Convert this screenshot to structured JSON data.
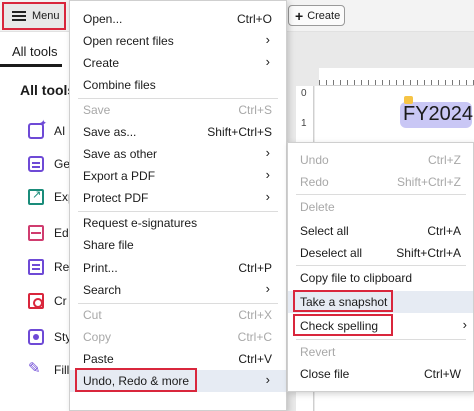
{
  "header": {
    "menu_label": "Menu",
    "create_label": "Create"
  },
  "sidebar": {
    "tab_label": "All tools",
    "panel_title": "All tools",
    "tools": [
      {
        "label": "AI",
        "icon": "ai-assistant-icon"
      },
      {
        "label": "Ge",
        "icon": "generate-icon"
      },
      {
        "label": "Exp",
        "icon": "export-pdf-icon"
      },
      {
        "label": "Ed",
        "icon": "edit-pdf-icon"
      },
      {
        "label": "Re",
        "icon": "request-signature-icon"
      },
      {
        "label": "Cr",
        "icon": "create-pdf-icon"
      },
      {
        "label": "Sty",
        "icon": "style-icon"
      },
      {
        "label": "Fill",
        "icon": "fill-sign-icon"
      }
    ]
  },
  "document": {
    "ruler_mark_0": "0",
    "ruler_mark_1": "1",
    "text_box": "FY2024"
  },
  "main_menu": {
    "items": [
      {
        "label": "Open...",
        "shortcut": "Ctrl+O"
      },
      {
        "label": "Open recent files",
        "submenu": "›"
      },
      {
        "label": "Create",
        "submenu": "›"
      },
      {
        "label": "Combine files"
      },
      {
        "label": "Save",
        "shortcut": "Ctrl+S"
      },
      {
        "label": "Save as...",
        "shortcut": "Shift+Ctrl+S"
      },
      {
        "label": "Save as other",
        "submenu": "›"
      },
      {
        "label": "Export a PDF",
        "submenu": "›"
      },
      {
        "label": "Protect PDF",
        "submenu": "›"
      },
      {
        "label": "Request e-signatures"
      },
      {
        "label": "Share file"
      },
      {
        "label": "Print...",
        "shortcut": "Ctrl+P"
      },
      {
        "label": "Search",
        "submenu": "›"
      },
      {
        "label": "Cut",
        "shortcut": "Ctrl+X"
      },
      {
        "label": "Copy",
        "shortcut": "Ctrl+C"
      },
      {
        "label": "Paste",
        "shortcut": "Ctrl+V"
      },
      {
        "label": "Undo, Redo & more",
        "submenu": "›"
      }
    ]
  },
  "sub_menu": {
    "items": [
      {
        "label": "Undo",
        "shortcut": "Ctrl+Z"
      },
      {
        "label": "Redo",
        "shortcut": "Shift+Ctrl+Z"
      },
      {
        "label": "Delete"
      },
      {
        "label": "Select all",
        "shortcut": "Ctrl+A"
      },
      {
        "label": "Deselect all",
        "shortcut": "Shift+Ctrl+A"
      },
      {
        "label": "Copy file to clipboard"
      },
      {
        "label": "Take a snapshot"
      },
      {
        "label": "Check spelling",
        "submenu": "›"
      },
      {
        "label": "Revert"
      },
      {
        "label": "Close file",
        "shortcut": "Ctrl+W"
      }
    ]
  },
  "colors": {
    "highlight_red": "#d9263c",
    "hover_bg": "#e6ebf3",
    "disabled_text": "#a8a8a8",
    "text_box_bg": "#c9c7f5"
  }
}
